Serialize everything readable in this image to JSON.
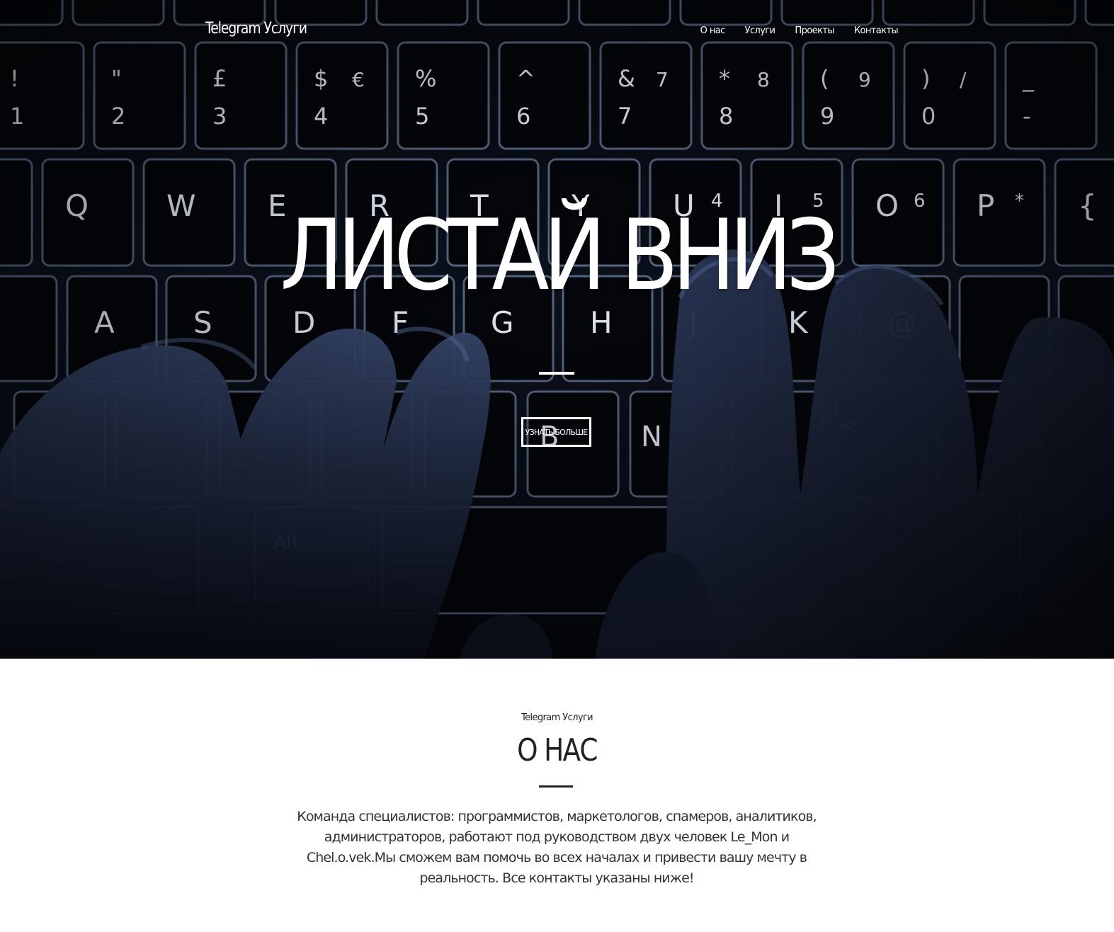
{
  "header": {
    "brand": "Telegram Услуги",
    "nav": [
      "О нас",
      "Услуги",
      "Проекты",
      "Контакты"
    ]
  },
  "hero": {
    "title": "ЛИСТАЙ ВНИЗ",
    "button": "УЗНАТЬ БОЛЬШЕ",
    "keyboard_keys": {
      "row1_top": [
        "!",
        "\"",
        "£",
        "$",
        "%",
        "^",
        "&",
        "*",
        "(",
        ")",
        "_"
      ],
      "row1_bottom": [
        "1",
        "2",
        "3",
        "4",
        "5",
        "6",
        "7",
        "8",
        "9",
        "0",
        "-"
      ],
      "row1_alt": [
        "",
        "",
        "",
        "€",
        "",
        "",
        "7",
        "8",
        "9",
        "/",
        ""
      ],
      "row2": [
        "Q",
        "W",
        "E",
        "R",
        "T",
        "Y",
        "U",
        "I",
        "O",
        "P",
        "{"
      ],
      "row2_alt": [
        "",
        "",
        "",
        "",
        "",
        "",
        "4",
        "5",
        "6",
        "*",
        "["
      ],
      "row3": [
        "A",
        "S",
        "D",
        "F",
        "G",
        "H",
        "J",
        "K",
        "@"
      ],
      "row4": [
        "B",
        "N",
        "<"
      ],
      "row5": [
        "Alt"
      ]
    }
  },
  "about": {
    "subtitle": "Telegram Услуги",
    "title": "О НАС",
    "text": "Команда специалистов: программистов, маркетологов, спамеров, аналитиков, администраторов, работают под руководством двух человек Le_Mon и Chel.o.vek.Мы сможем вам помочь во всех началах и привести вашу мечту в реальность. Все контакты указаны ниже!"
  },
  "colors": {
    "hero_bg": "#0a0f1a",
    "key_glow": "#9fb6e0",
    "hand": "#24304a",
    "text_light": "#ffffff",
    "text_dark": "#222222"
  }
}
